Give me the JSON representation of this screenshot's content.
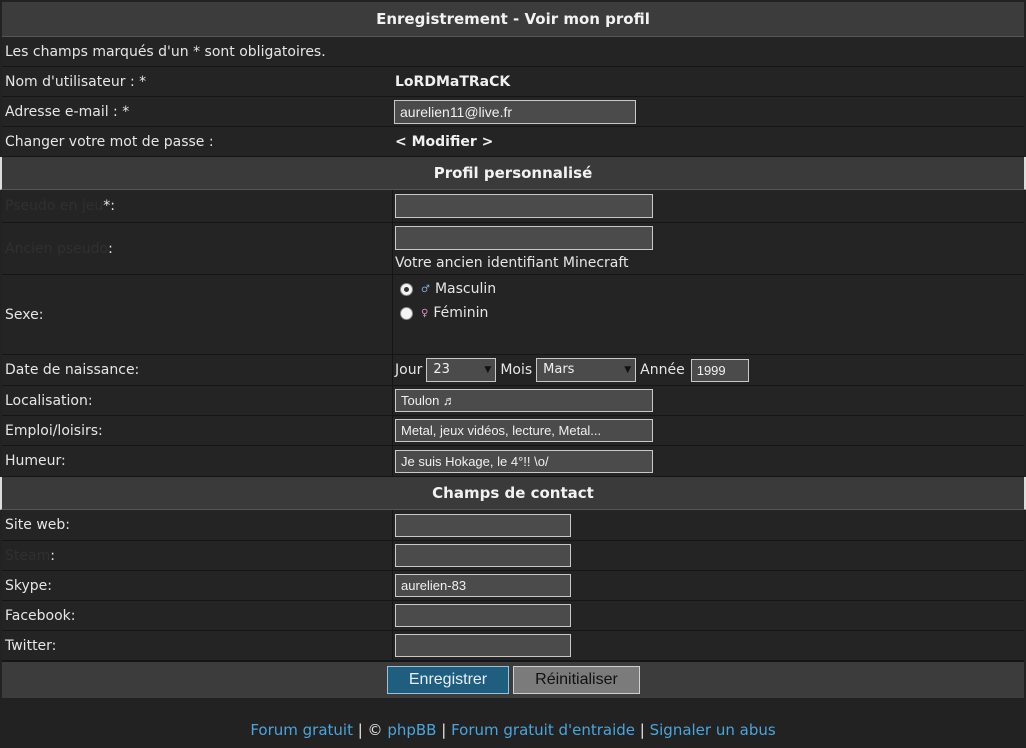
{
  "title": "Enregistrement - Voir mon profil",
  "notice": "Les champs marqués d'un * sont obligatoires.",
  "account": {
    "username_label": "Nom d'utilisateur : *",
    "username_value": "LoRDMaTRaCK",
    "email_label": "Adresse e-mail : *",
    "email_value": "aurelien11@live.fr",
    "password_label": "Changer votre mot de passe :",
    "password_link": "< Modifier >"
  },
  "profile": {
    "section_title": "Profil personnalisé",
    "pseudo_label_hidden": "Pseudo en jeu",
    "pseudo_label_suffix": " *:",
    "pseudo_value": "",
    "old_label_hidden": "Ancien pseudo",
    "old_label_suffix": " :",
    "old_value": "",
    "old_hint": "Votre ancien identifiant Minecraft",
    "sex_label": "Sexe:",
    "sex_options": [
      "Masculin",
      "Féminin"
    ],
    "birth_label": "Date de naissance:",
    "day_label": "Jour",
    "day_value": "23",
    "month_label": "Mois",
    "month_value": "Mars",
    "year_label": "Année",
    "year_value": "1999",
    "location_label": "Localisation:",
    "location_value": "Toulon ♬",
    "hobbies_label": "Emploi/loisirs:",
    "hobbies_value": "Metal, jeux vidéos, lecture, Metal...",
    "mood_label": "Humeur:",
    "mood_value": "Je suis Hokage, le 4°!! \\o/"
  },
  "contact": {
    "section_title": "Champs de contact",
    "website_label": "Site web:",
    "website_value": "",
    "hidden_label": "Steam",
    "hidden_suffix": ":",
    "hidden_value": "",
    "skype_label": "Skype:",
    "skype_value": "aurelien-83",
    "facebook_label": "Facebook:",
    "facebook_value": "",
    "twitter_label": "Twitter:",
    "twitter_value": ""
  },
  "buttons": {
    "save": "Enregistrer",
    "reset": "Réinitialiser"
  },
  "footer": {
    "link1": "Forum gratuit",
    "sep1": " | © ",
    "link2": "phpBB",
    "sep2": " | ",
    "link3": "Forum gratuit d'entraide",
    "sep3": " | ",
    "link4": "Signaler un abus"
  },
  "icons": {
    "male": "male-icon",
    "female": "female-icon",
    "dropdown": "chevron-down-icon"
  },
  "colors": {
    "background": "#222222",
    "header": "#3c3c3c",
    "link": "#4aa5dc",
    "save_button": "#1f5e7f"
  }
}
